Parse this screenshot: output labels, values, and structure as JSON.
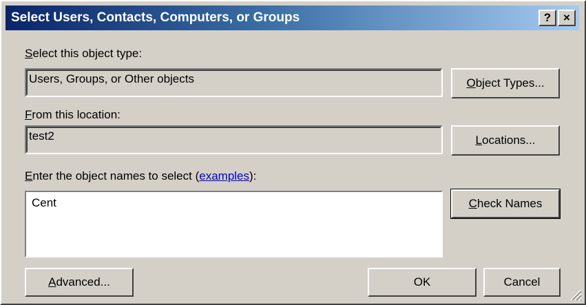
{
  "window": {
    "title": "Select Users, Contacts, Computers, or Groups",
    "help_glyph": "?",
    "close_glyph": "×"
  },
  "object_type": {
    "label_prefix": "",
    "label_accel": "S",
    "label_rest": "elect this object type:",
    "value": "Users, Groups, or Other objects",
    "button_accel": "O",
    "button_rest": "bject Types..."
  },
  "location": {
    "label_accel": "F",
    "label_rest": "rom this location:",
    "value": "test2",
    "button_accel": "L",
    "button_rest": "ocations..."
  },
  "names": {
    "label_accel": "E",
    "label_rest": "nter the object names to select (",
    "link": "examples",
    "label_end": "):",
    "value": "Cent",
    "check_accel": "C",
    "check_rest": "heck Names"
  },
  "footer": {
    "advanced_accel": "A",
    "advanced_rest": "dvanced...",
    "ok": "OK",
    "cancel": "Cancel"
  }
}
